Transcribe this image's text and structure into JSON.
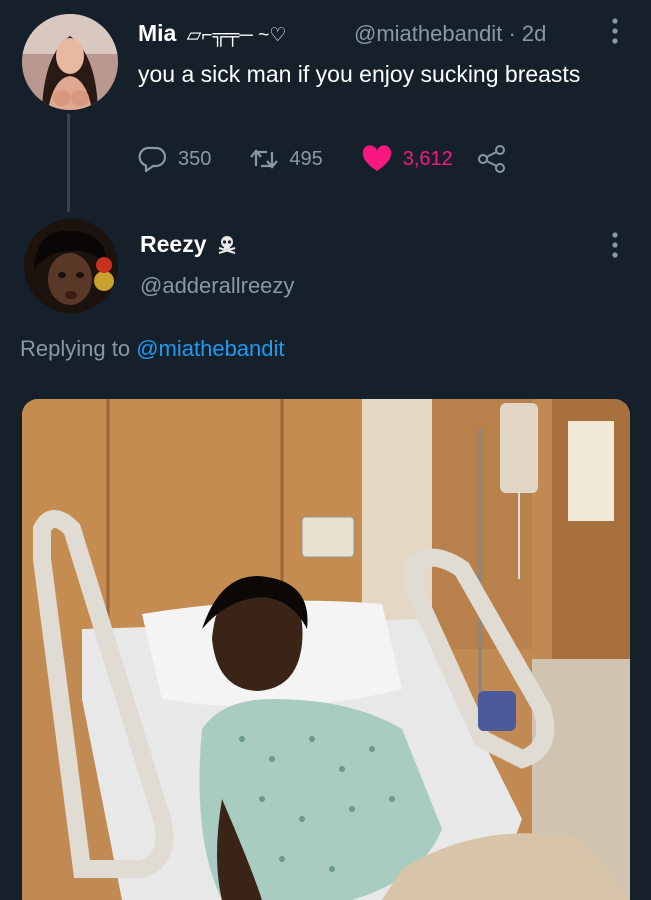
{
  "tweet1": {
    "name": "Mia",
    "name_decoration": "▱⌐╦╤─ ~♡",
    "handle": "@miathebandit",
    "separator": "·",
    "time": "2d",
    "text": "you a sick man if you enjoy sucking breasts",
    "replies": "350",
    "retweets": "495",
    "likes": "3,612",
    "liked": true,
    "like_color": "#f91880"
  },
  "tweet2": {
    "name": "Reezy",
    "name_emoji": "skull-crossbones",
    "handle": "@adderallreezy",
    "replying_prefix": "Replying to",
    "replying_handle": "@miathebandit"
  },
  "colors": {
    "background": "#15202b",
    "secondary_text": "#8899a6",
    "link": "#1d9bf0"
  }
}
